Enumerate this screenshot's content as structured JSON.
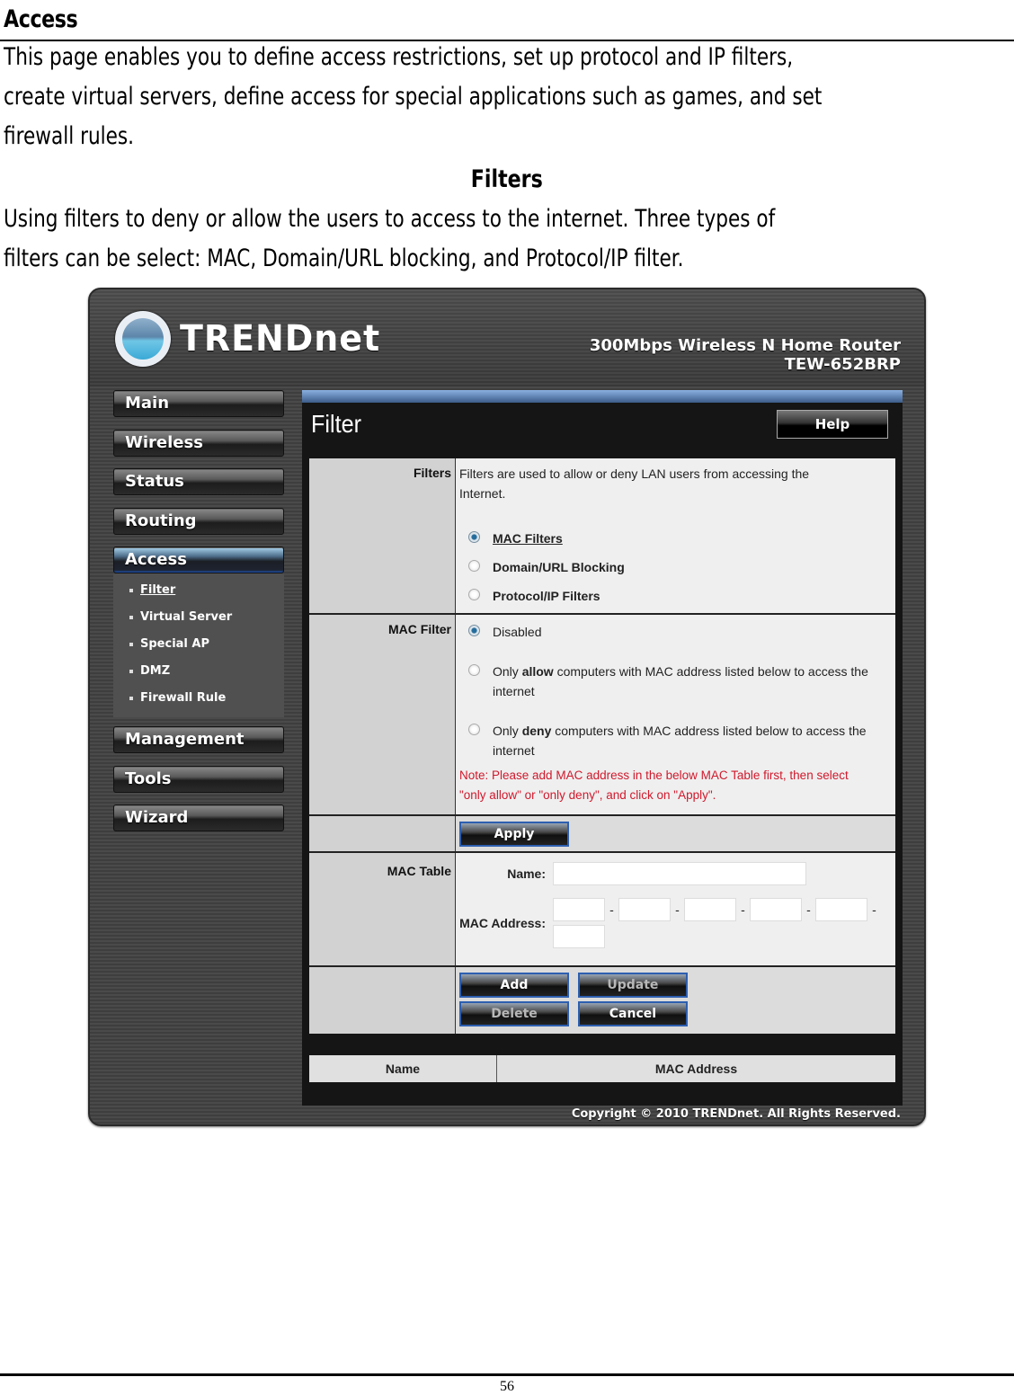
{
  "document": {
    "section_title": "Access",
    "intro_lines": [
      "This page enables you to define access restrictions, set up protocol and IP filters,",
      "create virtual servers, define access for special applications such as games, and set",
      "firewall rules."
    ],
    "subsection_title": "Filters",
    "subsection_lines": [
      "Using filters to deny or allow the users to access to the internet.  Three types of",
      "filters can be select: MAC, Domain/URL blocking, and Protocol/IP filter."
    ],
    "page_number": "56"
  },
  "router": {
    "brand": "TRENDnet",
    "product_line1": "300Mbps Wireless N Home Router",
    "product_line2": "TEW-652BRP",
    "nav": [
      {
        "label": "Main"
      },
      {
        "label": "Wireless"
      },
      {
        "label": "Status"
      },
      {
        "label": "Routing"
      },
      {
        "label": "Access",
        "active": true
      },
      {
        "label": "Management"
      },
      {
        "label": "Tools"
      },
      {
        "label": "Wizard"
      }
    ],
    "subnav": [
      {
        "label": "Filter",
        "current": true
      },
      {
        "label": "Virtual Server"
      },
      {
        "label": "Special AP"
      },
      {
        "label": "DMZ"
      },
      {
        "label": "Firewall Rule"
      }
    ],
    "page_title": "Filter",
    "help_label": "Help",
    "filters": {
      "label": "Filters",
      "description": "Filters are used to allow or deny LAN users from accessing the Internet.",
      "options": [
        {
          "label": "MAC Filters",
          "checked": true
        },
        {
          "label": "Domain/URL Blocking",
          "checked": false
        },
        {
          "label": "Protocol/IP Filters",
          "checked": false
        }
      ]
    },
    "mac_filter": {
      "label": "MAC Filter",
      "option_disabled": "Disabled",
      "option_allow_pre": "Only ",
      "option_allow_bold": "allow",
      "option_allow_post": " computers with MAC address listed below to access the internet",
      "option_deny_pre": "Only ",
      "option_deny_bold": "deny",
      "option_deny_post": " computers with MAC address listed below to access the internet",
      "selected": "Disabled",
      "note": "Note: Please add MAC address in the below MAC Table first, then select \"only allow\" or \"only deny\", and click on \"Apply\"."
    },
    "apply_label": "Apply",
    "mac_table": {
      "label": "MAC Table",
      "name_label": "Name:",
      "name_value": "",
      "mac_label": "MAC Address:",
      "mac_octets": [
        "",
        "",
        "",
        "",
        "",
        ""
      ],
      "separator": "-"
    },
    "buttons": {
      "add": "Add",
      "update": "Update",
      "delete": "Delete",
      "cancel": "Cancel"
    },
    "list_columns": [
      "Name",
      "MAC Address"
    ],
    "copyright": "Copyright © 2010 TRENDnet. All Rights Reserved."
  }
}
